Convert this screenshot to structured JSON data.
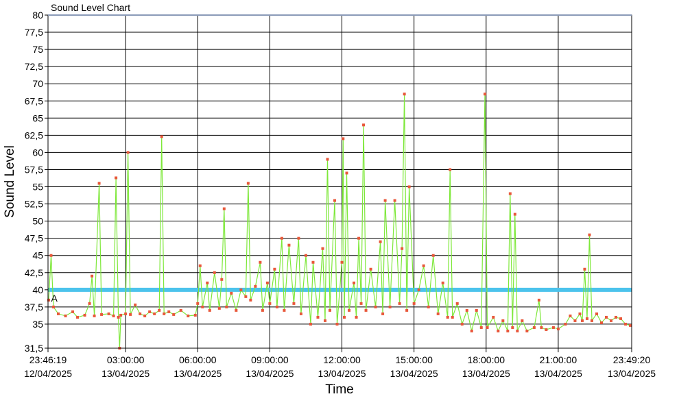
{
  "chart_data": {
    "type": "line",
    "title": "Sound Level Chart",
    "xlabel": "Time",
    "ylabel": "Sound Level",
    "ylim": [
      31.5,
      80
    ],
    "y_ticks": [
      "31,5",
      "35",
      "37,5",
      "40",
      "42,5",
      "45",
      "47,5",
      "50",
      "52,5",
      "55",
      "57,5",
      "60",
      "62,5",
      "65",
      "67,5",
      "70",
      "72,5",
      "75",
      "77,5",
      "80"
    ],
    "x_range_hours": [
      -0.2281,
      24.0556
    ],
    "x_ticks": [
      {
        "time": "23:46:19",
        "date": "12/04/2025",
        "hour": -0.2281
      },
      {
        "time": "03:00:00",
        "date": "13/04/2025",
        "hour": 3
      },
      {
        "time": "06:00:00",
        "date": "13/04/2025",
        "hour": 6
      },
      {
        "time": "09:00:00",
        "date": "13/04/2025",
        "hour": 9
      },
      {
        "time": "12:00:00",
        "date": "13/04/2025",
        "hour": 12
      },
      {
        "time": "15:00:00",
        "date": "13/04/2025",
        "hour": 15
      },
      {
        "time": "18:00:00",
        "date": "13/04/2025",
        "hour": 18
      },
      {
        "time": "21:00:00",
        "date": "13/04/2025",
        "hour": 21
      },
      {
        "time": "23:49:20",
        "date": "13/04/2025",
        "hour": 24.0556
      }
    ],
    "grid": true,
    "threshold": {
      "value": 40,
      "color": "#4cc3ec"
    },
    "annotation": {
      "text": "A",
      "hour": -0.1,
      "value": 38.3
    },
    "series": [
      {
        "color": "#7ee83a",
        "marker_color": "#e8573a",
        "points": [
          [
            -0.2,
            38.5
          ],
          [
            -0.1,
            45.0
          ],
          [
            0.0,
            37.5
          ],
          [
            0.2,
            36.5
          ],
          [
            0.5,
            36.2
          ],
          [
            0.8,
            36.8
          ],
          [
            1.0,
            36.0
          ],
          [
            1.3,
            36.3
          ],
          [
            1.5,
            38.0
          ],
          [
            1.6,
            42.0
          ],
          [
            1.7,
            36.2
          ],
          [
            1.9,
            55.5
          ],
          [
            2.0,
            36.4
          ],
          [
            2.3,
            36.5
          ],
          [
            2.5,
            36.2
          ],
          [
            2.6,
            56.3
          ],
          [
            2.7,
            36.0
          ],
          [
            2.75,
            31.5
          ],
          [
            2.8,
            36.3
          ],
          [
            3.0,
            36.5
          ],
          [
            3.1,
            60.0
          ],
          [
            3.2,
            36.4
          ],
          [
            3.4,
            37.8
          ],
          [
            3.6,
            36.5
          ],
          [
            3.8,
            36.2
          ],
          [
            4.0,
            36.8
          ],
          [
            4.2,
            36.5
          ],
          [
            4.4,
            37.0
          ],
          [
            4.5,
            62.3
          ],
          [
            4.6,
            36.5
          ],
          [
            4.8,
            36.8
          ],
          [
            5.0,
            36.4
          ],
          [
            5.3,
            37.0
          ],
          [
            5.6,
            36.2
          ],
          [
            5.9,
            36.3
          ],
          [
            6.0,
            38.0
          ],
          [
            6.1,
            43.5
          ],
          [
            6.2,
            37.5
          ],
          [
            6.4,
            41.0
          ],
          [
            6.5,
            37.0
          ],
          [
            6.7,
            42.5
          ],
          [
            6.9,
            37.3
          ],
          [
            7.0,
            41.5
          ],
          [
            7.1,
            51.8
          ],
          [
            7.2,
            37.5
          ],
          [
            7.4,
            39.5
          ],
          [
            7.6,
            37.0
          ],
          [
            7.8,
            40.0
          ],
          [
            8.0,
            39.0
          ],
          [
            8.1,
            55.5
          ],
          [
            8.2,
            38.5
          ],
          [
            8.4,
            40.5
          ],
          [
            8.6,
            44.0
          ],
          [
            8.7,
            37.0
          ],
          [
            8.9,
            41.0
          ],
          [
            9.0,
            38.0
          ],
          [
            9.2,
            43.0
          ],
          [
            9.3,
            37.5
          ],
          [
            9.5,
            47.5
          ],
          [
            9.6,
            37.0
          ],
          [
            9.8,
            46.5
          ],
          [
            10.0,
            38.0
          ],
          [
            10.2,
            47.5
          ],
          [
            10.3,
            36.5
          ],
          [
            10.5,
            45.0
          ],
          [
            10.7,
            35.0
          ],
          [
            10.8,
            44.0
          ],
          [
            11.0,
            36.0
          ],
          [
            11.2,
            46.0
          ],
          [
            11.3,
            35.5
          ],
          [
            11.4,
            59.0
          ],
          [
            11.5,
            37.0
          ],
          [
            11.7,
            53.0
          ],
          [
            11.8,
            35.0
          ],
          [
            12.0,
            44.0
          ],
          [
            12.05,
            62.0
          ],
          [
            12.1,
            36.0
          ],
          [
            12.2,
            57.0
          ],
          [
            12.3,
            37.0
          ],
          [
            12.5,
            41.0
          ],
          [
            12.6,
            36.0
          ],
          [
            12.7,
            47.5
          ],
          [
            12.8,
            38.0
          ],
          [
            12.9,
            64.0
          ],
          [
            13.0,
            37.0
          ],
          [
            13.2,
            43.0
          ],
          [
            13.4,
            37.5
          ],
          [
            13.6,
            47.0
          ],
          [
            13.7,
            36.5
          ],
          [
            13.8,
            53.0
          ],
          [
            14.0,
            37.5
          ],
          [
            14.2,
            53.0
          ],
          [
            14.4,
            38.0
          ],
          [
            14.5,
            46.0
          ],
          [
            14.6,
            68.5
          ],
          [
            14.7,
            37.0
          ],
          [
            14.8,
            55.0
          ],
          [
            15.0,
            38.0
          ],
          [
            15.2,
            40.0
          ],
          [
            15.4,
            43.5
          ],
          [
            15.6,
            37.5
          ],
          [
            15.8,
            45.0
          ],
          [
            16.0,
            36.5
          ],
          [
            16.2,
            41.0
          ],
          [
            16.4,
            36.0
          ],
          [
            16.5,
            57.5
          ],
          [
            16.6,
            36.0
          ],
          [
            16.8,
            38.0
          ],
          [
            17.0,
            35.0
          ],
          [
            17.2,
            37.0
          ],
          [
            17.4,
            34.0
          ],
          [
            17.6,
            37.0
          ],
          [
            17.8,
            34.5
          ],
          [
            17.95,
            68.5
          ],
          [
            18.05,
            34.5
          ],
          [
            18.3,
            36.0
          ],
          [
            18.5,
            34.0
          ],
          [
            18.7,
            35.5
          ],
          [
            18.9,
            34.0
          ],
          [
            19.0,
            54.0
          ],
          [
            19.1,
            34.5
          ],
          [
            19.2,
            51.0
          ],
          [
            19.3,
            34.0
          ],
          [
            19.5,
            35.5
          ],
          [
            19.7,
            34.0
          ],
          [
            20.0,
            34.5
          ],
          [
            20.2,
            38.5
          ],
          [
            20.3,
            34.5
          ],
          [
            20.5,
            34.2
          ],
          [
            20.8,
            34.5
          ],
          [
            21.0,
            34.3
          ],
          [
            21.3,
            35.0
          ],
          [
            21.5,
            36.2
          ],
          [
            21.7,
            35.5
          ],
          [
            21.9,
            36.5
          ],
          [
            22.0,
            35.5
          ],
          [
            22.1,
            43.0
          ],
          [
            22.2,
            35.8
          ],
          [
            22.3,
            48.0
          ],
          [
            22.4,
            35.5
          ],
          [
            22.6,
            36.5
          ],
          [
            22.8,
            35.2
          ],
          [
            23.0,
            36.0
          ],
          [
            23.2,
            35.5
          ],
          [
            23.4,
            36.0
          ],
          [
            23.6,
            35.8
          ],
          [
            23.8,
            35.0
          ],
          [
            24.0,
            34.8
          ]
        ]
      }
    ]
  }
}
